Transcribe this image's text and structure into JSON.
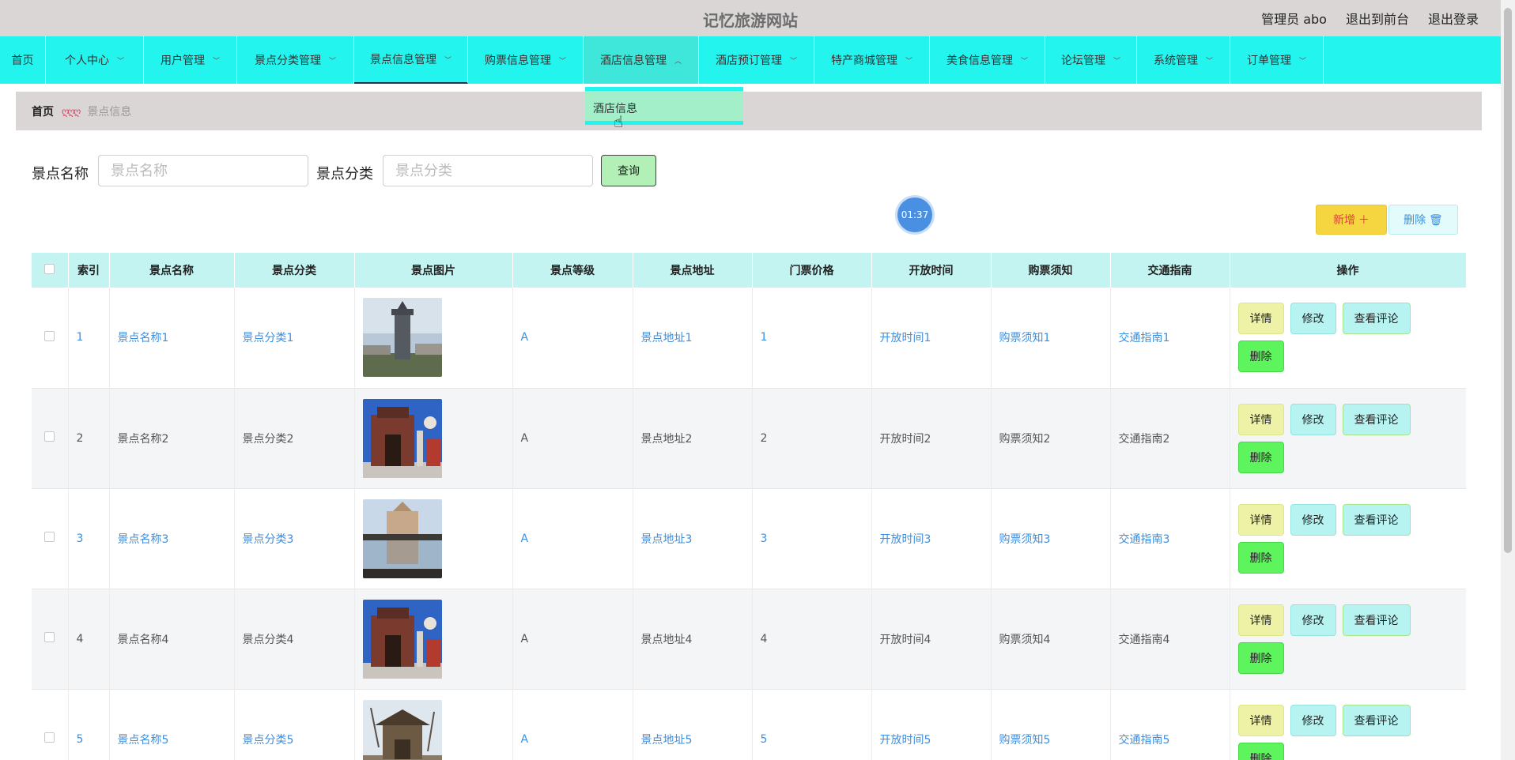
{
  "header": {
    "title": "记忆旅游网站",
    "user_label": "管理员 abo",
    "front_link": "退出到前台",
    "logout_link": "退出登录"
  },
  "nav": {
    "items": [
      {
        "label": "首页"
      },
      {
        "label": "个人中心"
      },
      {
        "label": "用户管理"
      },
      {
        "label": "景点分类管理"
      },
      {
        "label": "景点信息管理"
      },
      {
        "label": "购票信息管理"
      },
      {
        "label": "酒店信息管理"
      },
      {
        "label": "酒店预订管理"
      },
      {
        "label": "特产商城管理"
      },
      {
        "label": "美食信息管理"
      },
      {
        "label": "论坛管理"
      },
      {
        "label": "系统管理"
      },
      {
        "label": "订单管理"
      }
    ],
    "dropdown_item": "酒店信息"
  },
  "breadcrumb": {
    "home": "首页",
    "separator": "ღღღ",
    "current": "景点信息"
  },
  "search": {
    "name_label": "景点名称",
    "name_placeholder": "景点名称",
    "category_label": "景点分类",
    "category_placeholder": "景点分类",
    "query_button": "查询"
  },
  "timer": "01:37",
  "actions": {
    "add": "新增 ＋",
    "delete": "删除 🗑"
  },
  "table": {
    "headers": [
      "索引",
      "景点名称",
      "景点分类",
      "景点图片",
      "景点等级",
      "景点地址",
      "门票价格",
      "开放时间",
      "购票须知",
      "交通指南",
      "操作"
    ],
    "rows": [
      {
        "index": "1",
        "name": "景点名称1",
        "category": "景点分类1",
        "image": "photo-tower",
        "level": "A",
        "address": "景点地址1",
        "price": "1",
        "open_time": "开放时间1",
        "notice": "购票须知1",
        "guide": "交通指南1"
      },
      {
        "index": "2",
        "name": "景点名称2",
        "category": "景点分类2",
        "image": "photo-gate",
        "level": "A",
        "address": "景点地址2",
        "price": "2",
        "open_time": "开放时间2",
        "notice": "购票须知2",
        "guide": "交通指南2"
      },
      {
        "index": "3",
        "name": "景点名称3",
        "category": "景点分类3",
        "image": "photo-reflection",
        "level": "A",
        "address": "景点地址3",
        "price": "3",
        "open_time": "开放时间3",
        "notice": "购票须知3",
        "guide": "交通指南3"
      },
      {
        "index": "4",
        "name": "景点名称4",
        "category": "景点分类4",
        "image": "photo-gate",
        "level": "A",
        "address": "景点地址4",
        "price": "4",
        "open_time": "开放时间4",
        "notice": "购票须知4",
        "guide": "交通指南4"
      },
      {
        "index": "5",
        "name": "景点名称5",
        "category": "景点分类5",
        "image": "photo-pavilion",
        "level": "A",
        "address": "景点地址5",
        "price": "5",
        "open_time": "开放时间5",
        "notice": "购票须知5",
        "guide": "交通指南5"
      }
    ],
    "row_actions": {
      "detail": "详情",
      "edit": "修改",
      "comments": "查看评论",
      "delete": "删除"
    }
  },
  "colors": {
    "nav_bg": "#24f4ee",
    "header_bg": "#dbd6d6",
    "table_header_bg": "#c4f4f1",
    "link": "#3b8fe0",
    "add_button": "#f5d640",
    "delete_row_button": "#5ef45e"
  }
}
